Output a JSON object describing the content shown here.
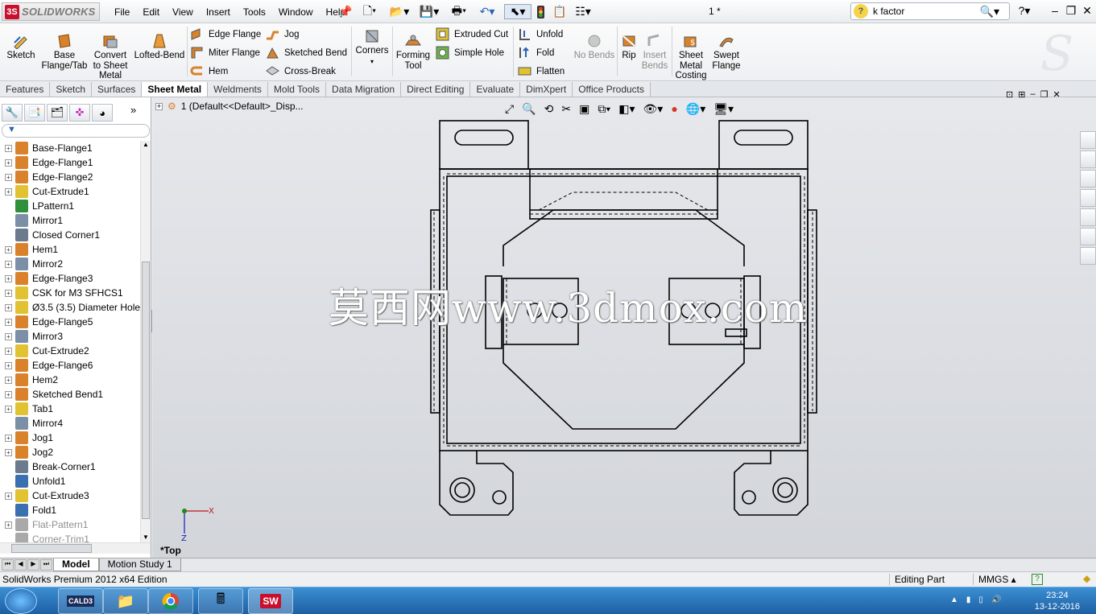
{
  "app": {
    "logo_text": "SOLIDWORKS",
    "doc_title": "1 *"
  },
  "menu": [
    "File",
    "Edit",
    "View",
    "Insert",
    "Tools",
    "Window",
    "Help"
  ],
  "search": {
    "value": "k factor"
  },
  "ribbon": {
    "sketch": "Sketch",
    "base_flange": [
      "Base",
      "Flange/Tab"
    ],
    "convert": [
      "Convert",
      "to Sheet",
      "Metal"
    ],
    "lofted_bend": "Lofted-Bend",
    "edge_flange": "Edge Flange",
    "miter_flange": "Miter Flange",
    "hem": "Hem",
    "jog": "Jog",
    "sketched_bend": "Sketched Bend",
    "cross_break": "Cross-Break",
    "corners": "Corners",
    "forming_tool": [
      "Forming",
      "Tool"
    ],
    "extruded_cut": "Extruded Cut",
    "simple_hole": "Simple Hole",
    "unfold": "Unfold",
    "fold": "Fold",
    "flatten": "Flatten",
    "no_bends": "No Bends",
    "rip": "Rip",
    "insert_bends": [
      "Insert",
      "Bends"
    ],
    "costing": [
      "Sheet",
      "Metal",
      "Costing"
    ],
    "swept_flange": [
      "Swept",
      "Flange"
    ]
  },
  "command_tabs": [
    "Features",
    "Sketch",
    "Surfaces",
    "Sheet Metal",
    "Weldments",
    "Mold Tools",
    "Data Migration",
    "Direct Editing",
    "Evaluate",
    "DimXpert",
    "Office Products"
  ],
  "active_tab": "Sheet Metal",
  "viewport": {
    "config_label": "1  (Default<<Default>_Disp...",
    "view_name": "*Top",
    "watermark": "莫西网www.3dmox.com"
  },
  "tree": [
    {
      "label": "Base-Flange1",
      "pm": true,
      "icon": "#d9822b"
    },
    {
      "label": "Edge-Flange1",
      "pm": true,
      "icon": "#d9822b"
    },
    {
      "label": "Edge-Flange2",
      "pm": true,
      "icon": "#d9822b"
    },
    {
      "label": "Cut-Extrude1",
      "pm": true,
      "icon": "#e1c233"
    },
    {
      "label": "LPattern1",
      "pm": false,
      "icon": "#2f8f3a"
    },
    {
      "label": "Mirror1",
      "pm": false,
      "icon": "#7b8fa6"
    },
    {
      "label": "Closed Corner1",
      "pm": false,
      "icon": "#6b7a8c"
    },
    {
      "label": "Hem1",
      "pm": true,
      "icon": "#d9822b"
    },
    {
      "label": "Mirror2",
      "pm": true,
      "icon": "#7b8fa6"
    },
    {
      "label": "Edge-Flange3",
      "pm": true,
      "icon": "#d9822b"
    },
    {
      "label": "CSK for M3 SFHCS1",
      "pm": true,
      "icon": "#e1c233"
    },
    {
      "label": "Ø3.5 (3.5) Diameter Hole1",
      "pm": true,
      "icon": "#e1c233"
    },
    {
      "label": "Edge-Flange5",
      "pm": true,
      "icon": "#d9822b"
    },
    {
      "label": "Mirror3",
      "pm": true,
      "icon": "#7b8fa6"
    },
    {
      "label": "Cut-Extrude2",
      "pm": true,
      "icon": "#e1c233"
    },
    {
      "label": "Edge-Flange6",
      "pm": true,
      "icon": "#d9822b"
    },
    {
      "label": "Hem2",
      "pm": true,
      "icon": "#d9822b"
    },
    {
      "label": "Sketched Bend1",
      "pm": true,
      "icon": "#d9822b"
    },
    {
      "label": "Tab1",
      "pm": true,
      "icon": "#e1c233"
    },
    {
      "label": "Mirror4",
      "pm": false,
      "icon": "#7b8fa6"
    },
    {
      "label": "Jog1",
      "pm": true,
      "icon": "#d9822b"
    },
    {
      "label": "Jog2",
      "pm": true,
      "icon": "#d9822b"
    },
    {
      "label": "Break-Corner1",
      "pm": false,
      "icon": "#6b7a8c"
    },
    {
      "label": "Unfold1",
      "pm": false,
      "icon": "#3a6fb0"
    },
    {
      "label": "Cut-Extrude3",
      "pm": true,
      "icon": "#e1c233"
    },
    {
      "label": "Fold1",
      "pm": false,
      "icon": "#3a6fb0"
    },
    {
      "label": "Flat-Pattern1",
      "pm": true,
      "icon": "#a9a9a9",
      "grey": true
    },
    {
      "label": "Corner-Trim1",
      "pm": false,
      "icon": "#a9a9a9",
      "grey": true
    }
  ],
  "bottom_tabs": [
    "Model",
    "Motion Study 1"
  ],
  "status": {
    "left": "SolidWorks Premium 2012 x64 Edition",
    "mode": "Editing Part",
    "units": "MMGS"
  },
  "taskbar": {
    "time": "23:24",
    "date": "13-12-2016",
    "cald3": "CALD3"
  }
}
